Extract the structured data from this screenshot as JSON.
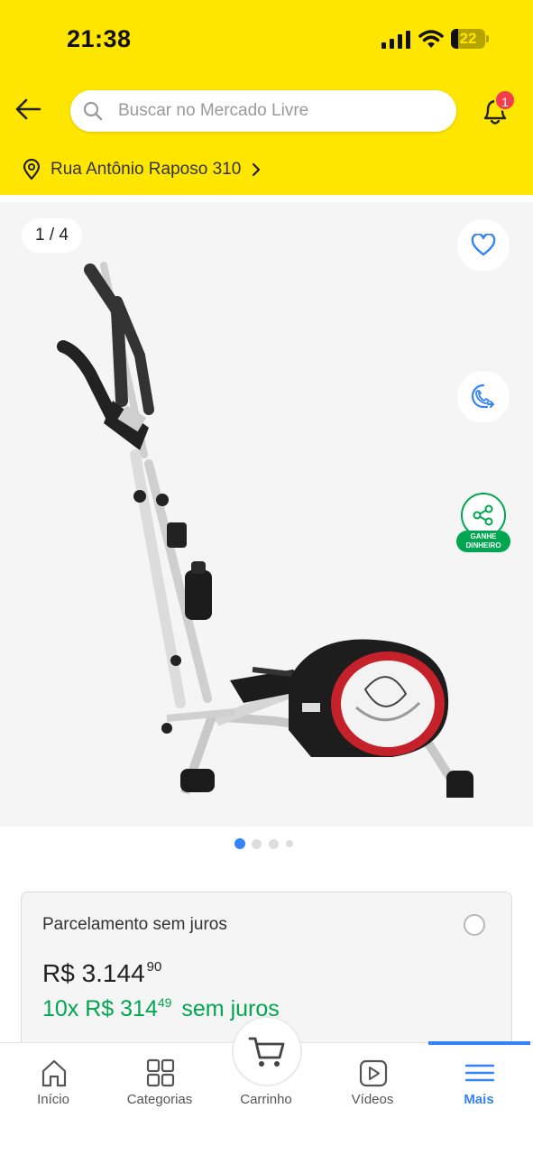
{
  "status_bar": {
    "time": "21:38",
    "battery": "22",
    "battery_level": 0.22
  },
  "search": {
    "placeholder": "Buscar no Mercado Livre"
  },
  "notifications": {
    "badge": "1"
  },
  "address": {
    "text": "Rua Antônio Raposo 310"
  },
  "gallery": {
    "counter": "1 / 4",
    "share_label_line1": "GANHE",
    "share_label_line2": "DINHEIRO",
    "total_images": 4,
    "active_index": 1
  },
  "payment": {
    "title": "Parcelamento sem juros",
    "price_main": "R$ 3.144",
    "price_cents": "90",
    "installment_main": "10x R$ 314",
    "installment_cents": "49",
    "installment_suffix": "sem juros"
  },
  "nav": {
    "items": [
      {
        "label": "Início",
        "icon": "home-icon"
      },
      {
        "label": "Categorias",
        "icon": "grid-icon"
      },
      {
        "label": "Carrinho",
        "icon": "cart-icon"
      },
      {
        "label": "Vídeos",
        "icon": "play-icon"
      },
      {
        "label": "Mais",
        "icon": "menu-icon"
      }
    ],
    "active": "Mais"
  },
  "colors": {
    "brand_yellow": "#ffe600",
    "accent_blue": "#3483fa",
    "green": "#00a650",
    "badge_red": "#f23d4f"
  }
}
